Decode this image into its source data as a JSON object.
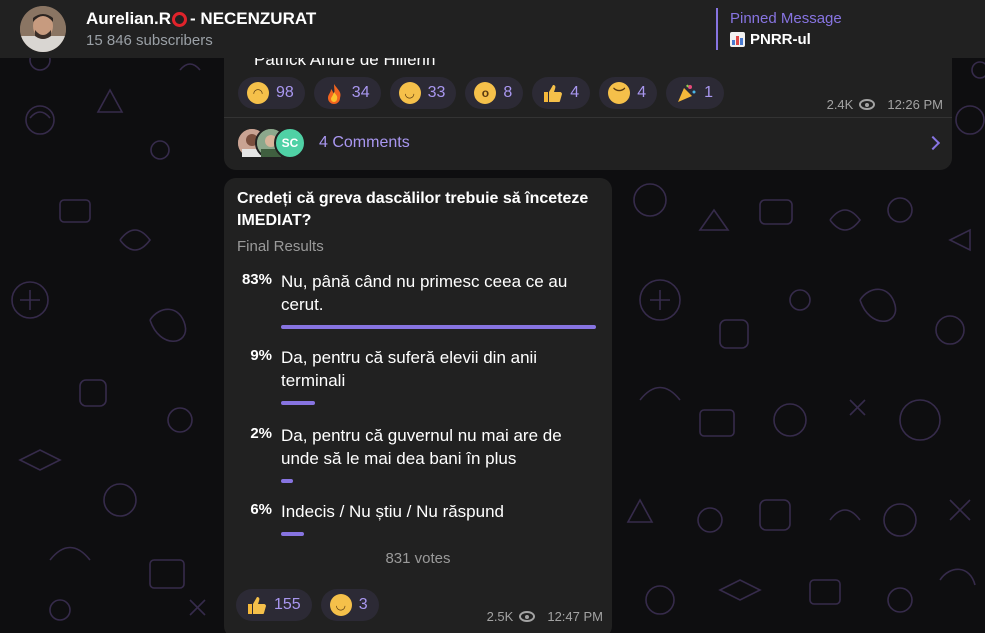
{
  "header": {
    "channel_name": "Aurelian.R",
    "channel_name_suffix": " - NECENZURAT",
    "subscribers": "15 846 subscribers",
    "pinned_title": "Pinned Message",
    "pinned_text": "PNRR-ul"
  },
  "message1": {
    "truncated_text": "Patrick Andre de Hillerin",
    "reactions": [
      {
        "icon": "cowboy-face-icon",
        "count": "98"
      },
      {
        "icon": "fire-icon",
        "count": "34"
      },
      {
        "icon": "grinning-face-icon",
        "count": "33"
      },
      {
        "icon": "screaming-face-icon",
        "count": "8"
      },
      {
        "icon": "thumbs-up-icon",
        "count": "4"
      },
      {
        "icon": "crying-face-icon",
        "count": "4"
      },
      {
        "icon": "party-popper-icon",
        "count": "1"
      }
    ],
    "views": "2.4K",
    "time": "12:26 PM",
    "comments_label": "4 Comments",
    "comment_avatar_initials": "SC"
  },
  "poll": {
    "question": "Credeți că greva dascălilor trebuie să înceteze IMEDIAT?",
    "status": "Final Results",
    "options": [
      {
        "percent": "83%",
        "text": "Nu, până când nu primesc ceea ce au cerut.",
        "fraction": 0.83
      },
      {
        "percent": "9%",
        "text": "Da, pentru că suferă elevii din anii terminali",
        "fraction": 0.09
      },
      {
        "percent": "2%",
        "text": "Da, pentru că guvernul nu mai are de unde să le mai dea bani în plus",
        "fraction": 0.02
      },
      {
        "percent": "6%",
        "text": "Indecis / Nu știu / Nu răspund",
        "fraction": 0.06
      }
    ],
    "votes": "831 votes",
    "reactions": [
      {
        "icon": "thumbs-up-icon",
        "count": "155"
      },
      {
        "icon": "grinning-face-icon",
        "count": "3"
      }
    ],
    "views": "2.5K",
    "time": "12:47 PM"
  },
  "colors": {
    "accent": "#8774e1",
    "bubble": "#212121",
    "doodle": "#3a2f4f"
  }
}
